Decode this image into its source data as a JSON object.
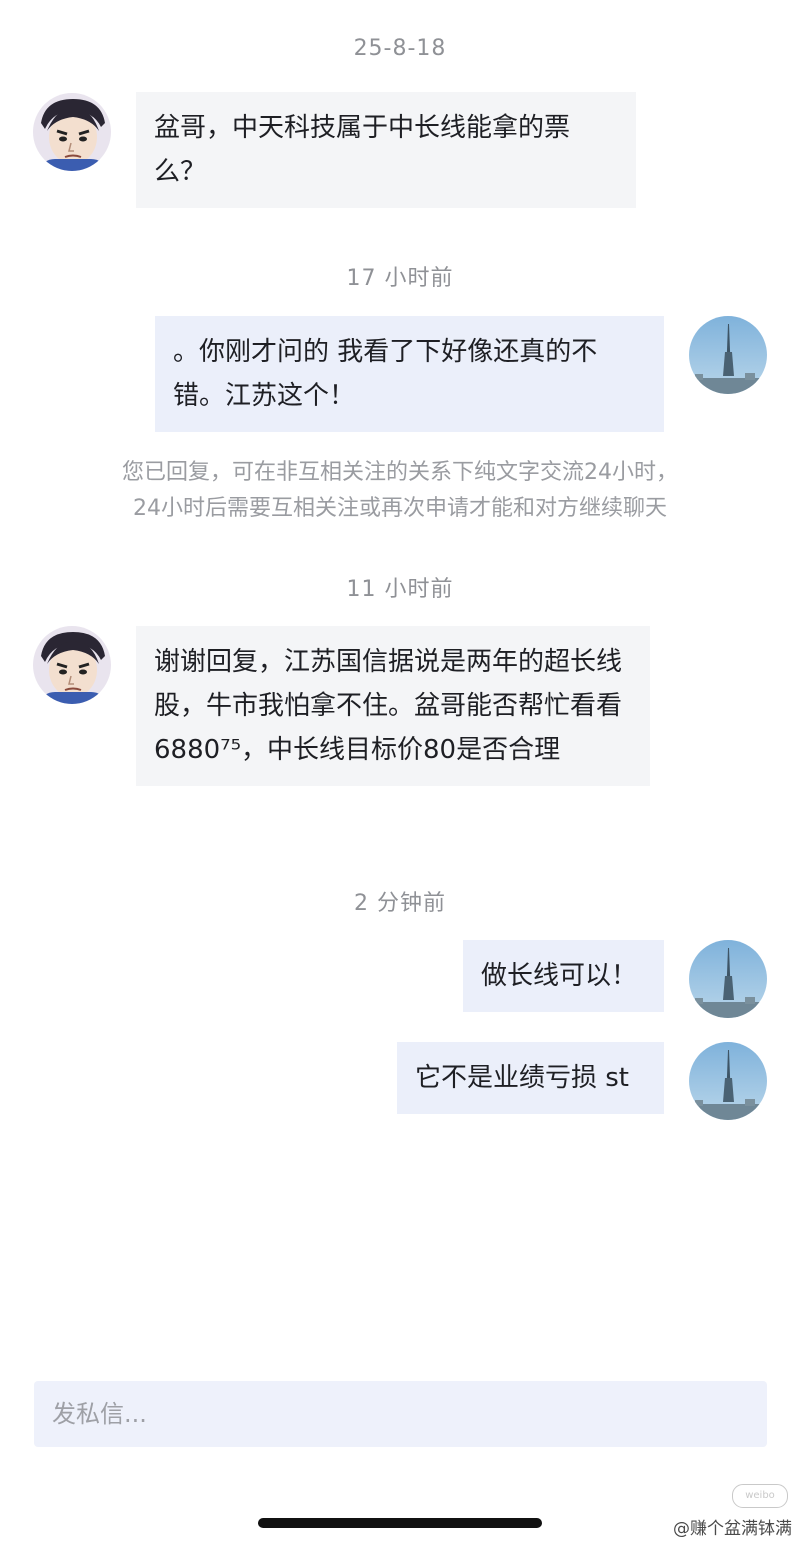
{
  "conversation": {
    "timestamps": [
      "25-8-18",
      "17 小时前",
      "11 小时前",
      "2 分钟前"
    ],
    "messages": [
      {
        "sender": "other",
        "text": "盆哥，中天科技属于中长线能拿的票么？"
      },
      {
        "sender": "me",
        "text": "。你刚才问的 我看了下好像还真的不错。江苏这个！"
      },
      {
        "sender": "other",
        "text": "谢谢回复，江苏国信据说是两年的超长线股，牛市我怕拿不住。盆哥能否帮忙看看6880⁷⁵，中长线目标价80是否合理"
      },
      {
        "sender": "me",
        "text": "做长线可以！"
      },
      {
        "sender": "me",
        "text": "它不是业绩亏损 st"
      }
    ],
    "notice": [
      "您已回复，可在非互相关注的关系下纯文字交流24小时，",
      "24小时后需要互相关注或再次申请才能和对方继续聊天"
    ]
  },
  "input": {
    "placeholder": "发私信..."
  },
  "watermark": {
    "text": "@赚个盆满钵满"
  },
  "icons": {
    "other_avatar": "cartoon-man-avatar",
    "my_avatar": "tower-skyline-avatar"
  },
  "colors": {
    "background": "#ffffff",
    "bubble_other": "#f4f5f7",
    "bubble_mine": "#ebeffa",
    "timestamp": "#8f9196",
    "input_bg": "#eef1fb"
  }
}
